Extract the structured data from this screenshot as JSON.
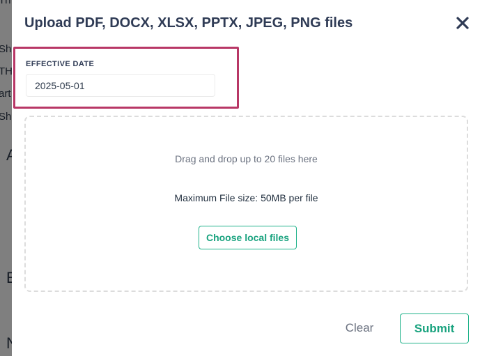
{
  "background": {
    "title_fragment": "Th",
    "lines": [
      "Sh",
      "TH",
      "art",
      "Sh"
    ],
    "large_letters": [
      "A",
      "E",
      "N"
    ]
  },
  "modal": {
    "title": "Upload PDF, DOCX, XLSX, PPTX, JPEG, PNG files",
    "close_icon": "close-x-icon",
    "effective_date": {
      "label": "EFFECTIVE DATE",
      "value": "2025-05-01"
    },
    "dropzone": {
      "hint": "Drag and drop up to 20 files here",
      "max_size": "Maximum File size: 50MB per file",
      "choose_label": "Choose local files"
    },
    "footer": {
      "clear_label": "Clear",
      "submit_label": "Submit"
    }
  },
  "colors": {
    "accent": "#1aa37f",
    "highlight": "#b83766",
    "title": "#2f3b55"
  }
}
